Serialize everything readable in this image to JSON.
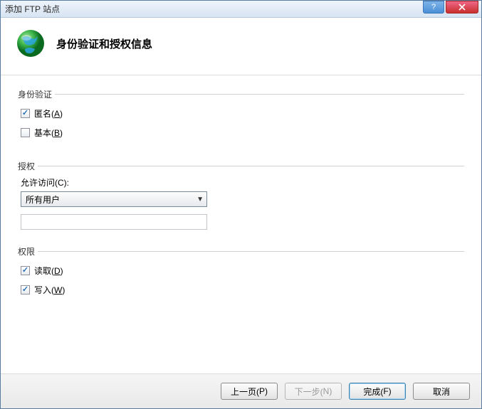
{
  "window": {
    "title": "添加 FTP 站点"
  },
  "header": {
    "title": "身份验证和授权信息"
  },
  "auth": {
    "legend": "身份验证",
    "anonymous": {
      "label": "匿名(",
      "key": "A",
      "suffix": ")",
      "checked": true
    },
    "basic": {
      "label": "基本(",
      "key": "B",
      "suffix": ")",
      "checked": false
    }
  },
  "authorization": {
    "legend": "授权",
    "allow_label": "允许访问(",
    "allow_key": "C",
    "allow_suffix": "):",
    "select_value": "所有用户"
  },
  "permissions": {
    "legend": "权限",
    "read": {
      "label": "读取(",
      "key": "D",
      "suffix": ")",
      "checked": true
    },
    "write": {
      "label": "写入(",
      "key": "W",
      "suffix": ")",
      "checked": true
    }
  },
  "footer": {
    "prev": "上一页(",
    "prev_key": "P",
    "prev_suffix": ")",
    "next": "下一步(",
    "next_key": "N",
    "next_suffix": ")",
    "finish": "完成(",
    "finish_key": "F",
    "finish_suffix": ")",
    "cancel": "取消"
  }
}
